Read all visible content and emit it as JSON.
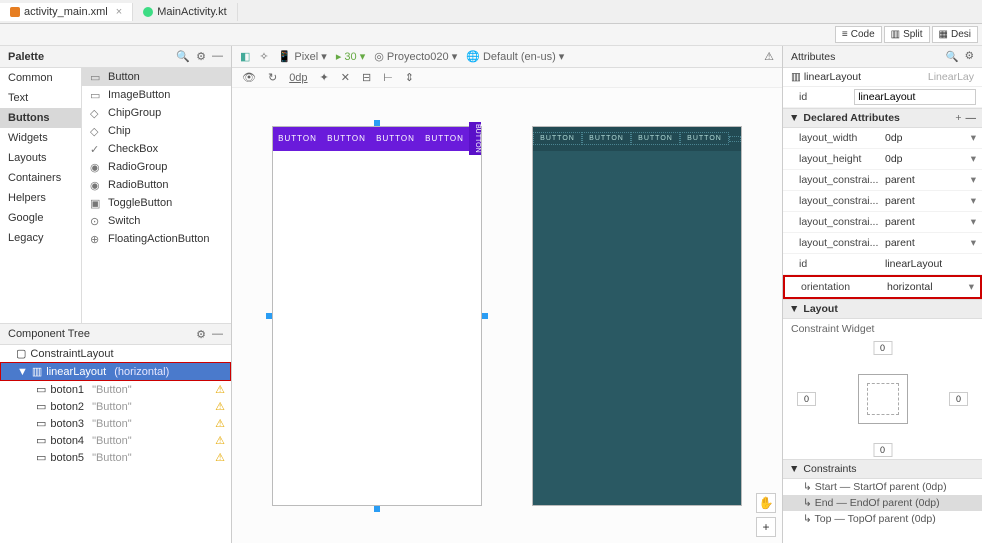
{
  "tabs": {
    "file1": "activity_main.xml",
    "file2": "MainActivity.kt"
  },
  "viewModes": {
    "code": "Code",
    "split": "Split",
    "design": "Desi"
  },
  "palette": {
    "title": "Palette",
    "categories": [
      "Common",
      "Text",
      "Buttons",
      "Widgets",
      "Layouts",
      "Containers",
      "Helpers",
      "Google",
      "Legacy"
    ],
    "items": [
      "Button",
      "ImageButton",
      "ChipGroup",
      "Chip",
      "CheckBox",
      "RadioGroup",
      "RadioButton",
      "ToggleButton",
      "Switch",
      "FloatingActionButton"
    ]
  },
  "componentTree": {
    "title": "Component Tree",
    "root": "ConstraintLayout",
    "selected": {
      "name": "linearLayout",
      "hint": "(horizontal)"
    },
    "children": [
      {
        "name": "boton1",
        "hint": "\"Button\""
      },
      {
        "name": "boton2",
        "hint": "\"Button\""
      },
      {
        "name": "boton3",
        "hint": "\"Button\""
      },
      {
        "name": "boton4",
        "hint": "\"Button\""
      },
      {
        "name": "boton5",
        "hint": "\"Button\""
      }
    ]
  },
  "designToolbar": {
    "device": "Pixel",
    "api": "30",
    "theme": "Proyecto020",
    "locale": "Default (en-us)"
  },
  "designToolbar2": {
    "dp": "0dp"
  },
  "buttonsLabel": "BUTTON",
  "attrs": {
    "title": "Attributes",
    "objName": "linearLayout",
    "objType": "LinearLay",
    "idLabel": "id",
    "idValue": "linearLayout",
    "declaredTitle": "Declared Attributes",
    "layoutTitle": "Layout",
    "constraintWidgetTitle": "Constraint Widget",
    "constraintsTitle": "Constraints",
    "rows": [
      {
        "key": "layout_width",
        "val": "0dp"
      },
      {
        "key": "layout_height",
        "val": "0dp"
      },
      {
        "key": "layout_constrai...",
        "val": "parent"
      },
      {
        "key": "layout_constrai...",
        "val": "parent"
      },
      {
        "key": "layout_constrai...",
        "val": "parent"
      },
      {
        "key": "layout_constrai...",
        "val": "parent"
      },
      {
        "key": "id",
        "val": "linearLayout"
      },
      {
        "key": "orientation",
        "val": "horizontal"
      }
    ],
    "cwVals": {
      "top": "0",
      "left": "0",
      "right": "0",
      "bottom": "0"
    },
    "constraints": [
      "Start — StartOf parent (0dp)",
      "End — EndOf parent (0dp)",
      "Top — TopOf parent (0dp)"
    ]
  }
}
